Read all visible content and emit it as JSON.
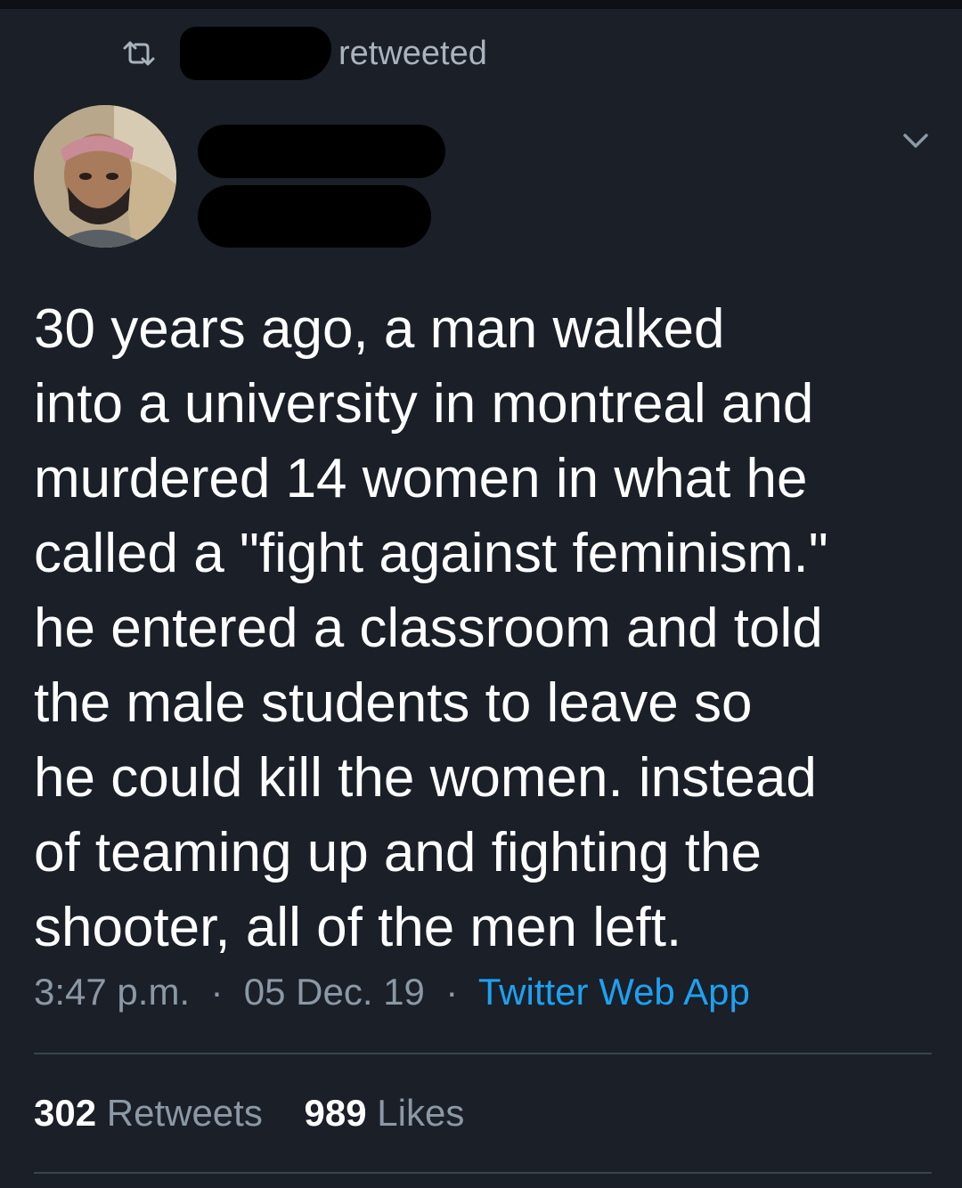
{
  "retweet_header": {
    "label": "retweeted",
    "icon": "retweet-icon"
  },
  "tweet": {
    "text": "30 years ago, a man walked\ninto a university in montreal and\nmurdered 14 women in what he\ncalled a \"fight against feminism.\"\nhe entered a classroom and told\nthe male students to leave so\nhe could kill the women. instead\nof teaming up and fighting the\nshooter, all of the men left.",
    "time": "3:47 p.m.",
    "date": "05 Dec. 19",
    "separator": "·",
    "source": "Twitter Web App"
  },
  "stats": {
    "retweets_count": "302",
    "retweets_label": "Retweets",
    "likes_count": "989",
    "likes_label": "Likes"
  },
  "colors": {
    "background": "#1a1f28",
    "text": "#ffffff",
    "muted": "#8b98a5",
    "link": "#1da1f2",
    "divider": "#38444d"
  }
}
